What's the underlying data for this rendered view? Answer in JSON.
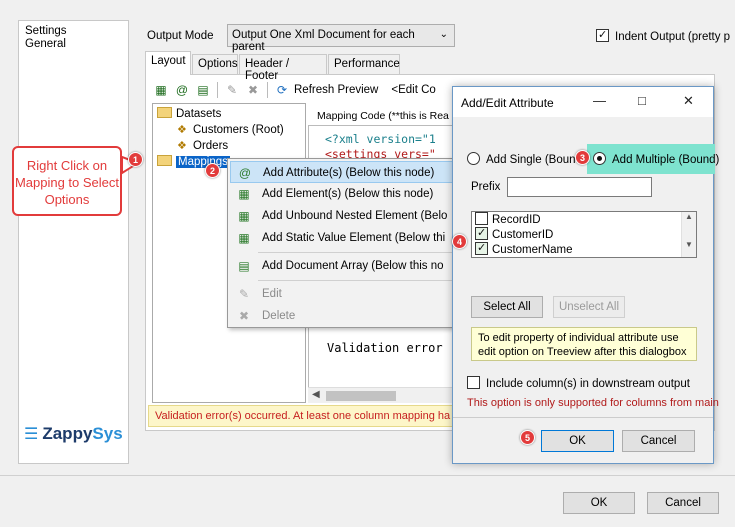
{
  "nav": {
    "item": "Settings General"
  },
  "header": {
    "output_mode_label": "Output Mode",
    "output_mode_value": "Output One Xml Document for each parent",
    "indent_label": "Indent Output (pretty p",
    "indent_checked": true
  },
  "tabs": [
    "Layout",
    "Options",
    "Header / Footer",
    "Performance"
  ],
  "toolbar": {
    "refresh_label": "Refresh Preview",
    "edit_label": "<Edit Co"
  },
  "tree": {
    "datasets": "Datasets",
    "customers": "Customers (Root)",
    "orders": "Orders",
    "mappings": "Mappings"
  },
  "code": {
    "label": "Mapping Code (**this is Rea",
    "line1": "<?xml version=\"1",
    "line2": "<settings vers=\"",
    "validation": "Validation error"
  },
  "validation_bar": "Validation error(s) occurred. At least one column mapping ha",
  "context_menu": {
    "items": [
      {
        "label": "Add Attribute(s) (Below this node)",
        "icon": "add-attribute-icon"
      },
      {
        "label": "Add Element(s) (Below this node)",
        "icon": "add-element-icon"
      },
      {
        "label": "Add Unbound Nested Element (Belo",
        "icon": "add-unbound-icon"
      },
      {
        "label": "Add Static Value Element (Below thi",
        "icon": "add-static-icon"
      },
      {
        "label": "Add Document Array (Below this no",
        "icon": "add-array-icon"
      },
      {
        "label": "Edit",
        "icon": "edit-icon"
      },
      {
        "label": "Delete",
        "icon": "delete-icon"
      }
    ]
  },
  "dialog": {
    "title": "Add/Edit Attribute",
    "radio_single": "Add Single (Boun",
    "radio_multiple": "Add Multiple (Bound)",
    "prefix_label": "Prefix",
    "prefix_value": "",
    "columns": [
      {
        "name": "RecordID",
        "checked": false
      },
      {
        "name": "CustomerID",
        "checked": true
      },
      {
        "name": "CustomerName",
        "checked": true
      }
    ],
    "select_all": "Select All",
    "unselect_all": "Unselect All",
    "tip": "To edit property of individual attribute use edit option on Treeview after this dialogbox",
    "include_label": "Include column(s) in downstream output",
    "only_supported": "This option is only supported for columns from main",
    "ok": "OK",
    "cancel": "Cancel"
  },
  "footer": {
    "ok": "OK",
    "cancel": "Cancel"
  },
  "annotation": {
    "callout": "Right Click on Mapping to Select Options",
    "badges": [
      "1",
      "2",
      "3",
      "4",
      "5"
    ]
  },
  "logo": {
    "brand1": "Zappy",
    "brand2": "Sys"
  }
}
